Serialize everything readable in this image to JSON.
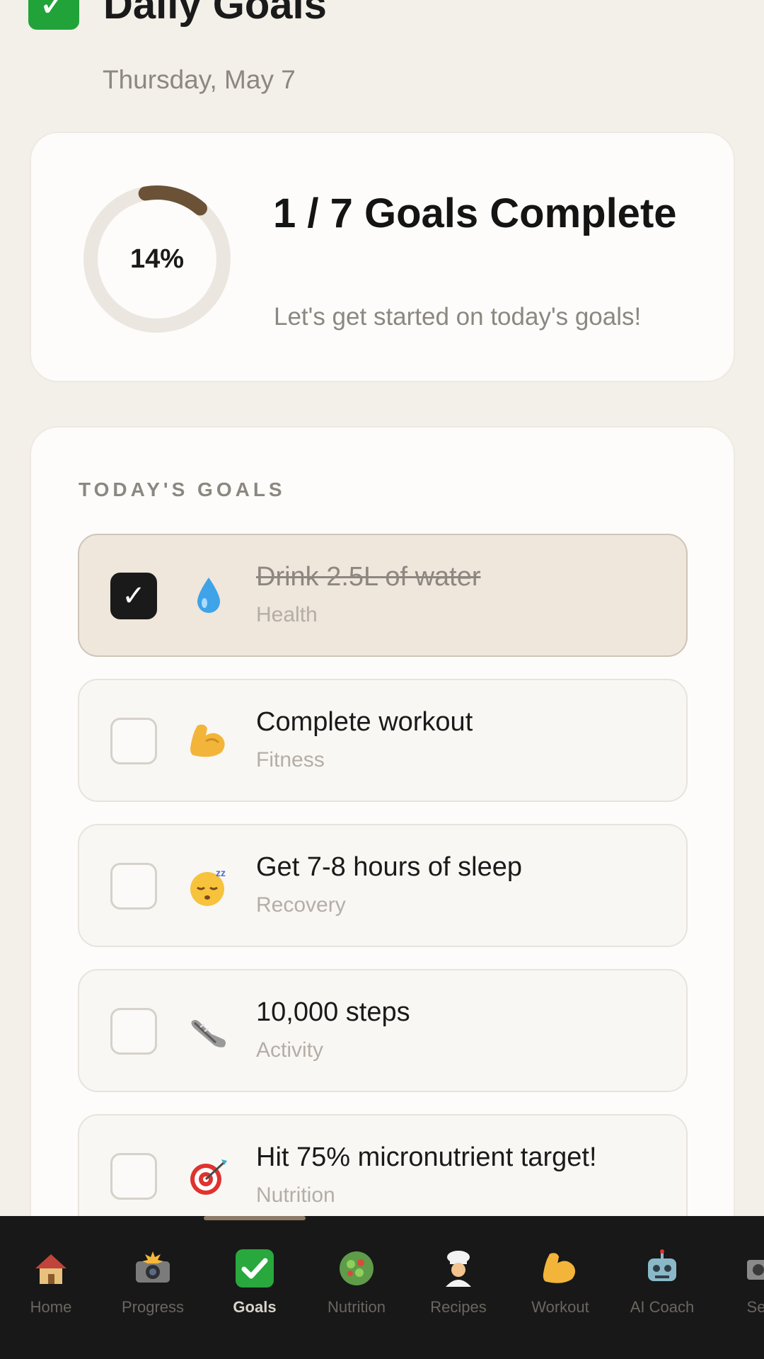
{
  "header": {
    "title": "Daily Goals",
    "date": "Thursday, May 7"
  },
  "progress": {
    "percent_label": "14%",
    "percent": 14,
    "title": "1 / 7 Goals Complete",
    "subtitle": "Let's get started on today's goals!"
  },
  "goals_section": {
    "label": "TODAY'S GOALS",
    "items": [
      {
        "title": "Drink 2.5L of water",
        "category": "Health",
        "icon": "water-drop-icon",
        "done": true
      },
      {
        "title": "Complete workout",
        "category": "Fitness",
        "icon": "flexed-biceps-icon",
        "done": false
      },
      {
        "title": "Get 7-8 hours of sleep",
        "category": "Recovery",
        "icon": "sleeping-face-icon",
        "done": false
      },
      {
        "title": "10,000 steps",
        "category": "Activity",
        "icon": "sneaker-icon",
        "done": false
      },
      {
        "title": "Hit 75% micronutrient target!",
        "category": "Nutrition",
        "icon": "target-icon",
        "done": false
      }
    ]
  },
  "nav": {
    "items": [
      {
        "label": "Home",
        "icon": "house-icon"
      },
      {
        "label": "Progress",
        "icon": "camera-flash-icon"
      },
      {
        "label": "Goals",
        "icon": "check-mark-icon",
        "active": true
      },
      {
        "label": "Nutrition",
        "icon": "salad-icon"
      },
      {
        "label": "Recipes",
        "icon": "chef-icon"
      },
      {
        "label": "Workout",
        "icon": "flexed-biceps-icon"
      },
      {
        "label": "AI Coach",
        "icon": "robot-icon"
      },
      {
        "label": "Sess",
        "icon": "projector-icon"
      }
    ]
  },
  "colors": {
    "background": "#f3efe9",
    "ring_track": "#ebe6df",
    "ring_progress": "#6b5237",
    "done_item_bg": "#efe6dc",
    "nav_bg": "#181818",
    "nav_indicator": "#8c7a66"
  }
}
